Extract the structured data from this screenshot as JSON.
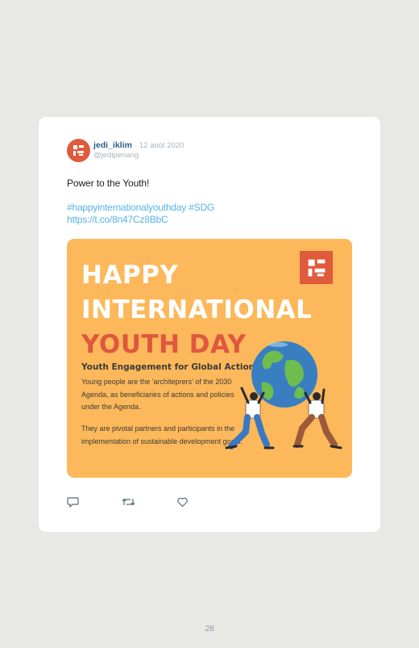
{
  "tweet": {
    "username": "jedi_iklim",
    "separator": "·",
    "date": "12 août 2020",
    "handle": "@jedipenang",
    "text": "Power to the Youth!",
    "hashtags": "#happyinternationalyouthday #SDG",
    "link": "https://t.co/8n47Cz8BbC"
  },
  "media": {
    "headline_1": "HAPPY",
    "headline_2": "INTERNATIONAL",
    "headline_3": "YOUTH DAY",
    "subheading": "Youth Engagement for Global Action",
    "paragraph_1": "Young people are the 'architeprers' of the 2030 Agenda, as beneficiaries of actions and policies under the Agenda.",
    "paragraph_2": "They are pivotal partners and participants in the implementation of sustainable development goals.",
    "logo_icon": "jedi-logo-icon",
    "illustration": "two-people-lifting-globe"
  },
  "actions": {
    "reply_icon": "reply-icon",
    "retweet_icon": "retweet-icon",
    "like_icon": "heart-icon"
  },
  "colors": {
    "background": "#e8e9e4",
    "card": "#ffffff",
    "username": "#2b5d8a",
    "link": "#56b3e6",
    "media_bg": "#fcb85a",
    "accent": "#df573e"
  },
  "page_number": "28"
}
